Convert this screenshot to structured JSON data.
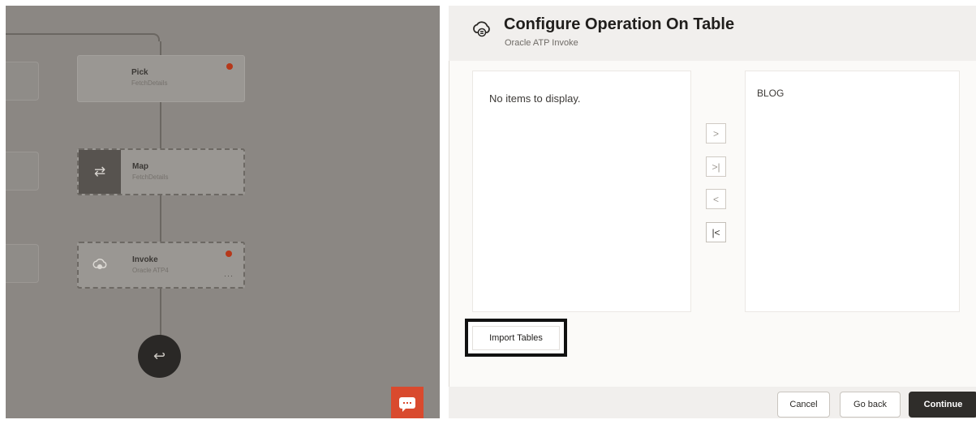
{
  "canvas": {
    "nodes": [
      {
        "title": "Pick",
        "subtitle": "FetchDetails",
        "has_error": true
      },
      {
        "title": "Map",
        "subtitle": "FetchDetails",
        "has_error": false,
        "icon": "map-arrows-icon"
      },
      {
        "title": "Invoke",
        "subtitle": "Oracle ATP4",
        "has_error": true,
        "icon": "atp-cloud-icon",
        "more": "···"
      }
    ],
    "end_icon": "return-arrow-icon",
    "chat_icon": "chat-bubble-icon"
  },
  "drawer": {
    "title": "Configure Operation On Table",
    "subtitle": "Oracle ATP Invoke",
    "available_empty_text": "No items to display.",
    "selected_items": [
      "BLOG"
    ],
    "shuttle_buttons": [
      ">",
      ">|",
      "<",
      "|<"
    ],
    "import_label": "Import Tables",
    "cancel_label": "Cancel",
    "goback_label": "Go back",
    "continue_label": "Continue"
  },
  "colors": {
    "canvas_overlay": "#8b8783",
    "error_dot": "#b6381a",
    "chat_button": "#d94a2e",
    "primary_button": "#2f2d2a"
  }
}
